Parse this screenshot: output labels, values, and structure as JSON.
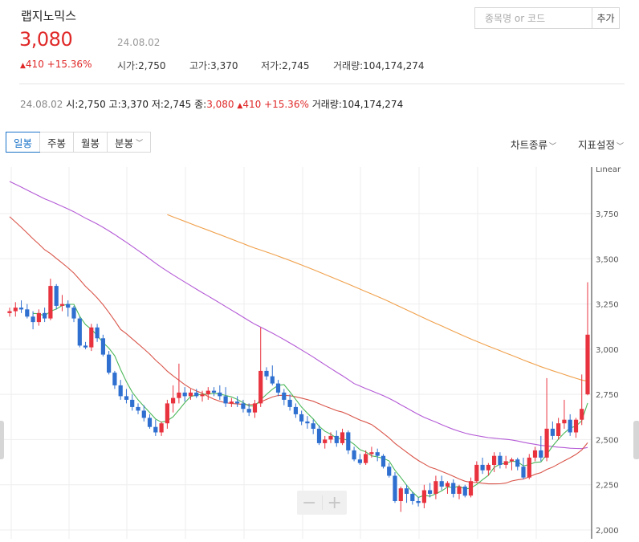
{
  "stock": {
    "name": "랩지노믹스",
    "price": "3,080",
    "date": "24.08.02",
    "change_arrow": "▲",
    "change": "410",
    "change_pct": "+15.36%"
  },
  "summary": {
    "open_label": "시가",
    "open": "2,750",
    "high_label": "고가",
    "high": "3,370",
    "low_label": "저가",
    "low": "2,745",
    "volume_label": "거래량",
    "volume": "104,174,274"
  },
  "search": {
    "placeholder": "종목명 or 코드",
    "add_label": "추가"
  },
  "ohlc_row": {
    "date": "24.08.02",
    "open_label": "시",
    "open": "2,750",
    "high_label": "고",
    "high": "3,370",
    "low_label": "저",
    "low": "2,745",
    "close_label": "종",
    "close": "3,080",
    "change_arrow": "▲",
    "change": "410",
    "change_pct": "+15.36%",
    "volume_label": "거래량",
    "volume": "104,174,274"
  },
  "toolbar": {
    "tabs": [
      {
        "label": "일봉",
        "active": true
      },
      {
        "label": "주봉"
      },
      {
        "label": "월봉"
      },
      {
        "label": "분봉",
        "dropdown": true
      }
    ],
    "chart_type_label": "차트종류",
    "indicator_label": "지표설정"
  },
  "colors": {
    "up": "#e8333f",
    "down": "#2e6fd0",
    "ma5": "#4cb85a",
    "ma20": "#d9554a",
    "ma60": "#b45ad6",
    "ma120": "#f0a04b",
    "accent": "#1a73c8"
  },
  "chart_data": {
    "type": "candlestick",
    "scale_label": "Linear",
    "y_ticks": [
      "3,750",
      "3,500",
      "3,250",
      "3,000",
      "2,750",
      "2,500",
      "2,250",
      "2,000"
    ],
    "ylim": [
      2000,
      3950
    ],
    "grid": true,
    "candles": [
      [
        3200,
        3230,
        3180,
        3210
      ],
      [
        3210,
        3260,
        3180,
        3230
      ],
      [
        3230,
        3270,
        3200,
        3220
      ],
      [
        3220,
        3250,
        3170,
        3180
      ],
      [
        3180,
        3210,
        3110,
        3150
      ],
      [
        3150,
        3220,
        3130,
        3200
      ],
      [
        3200,
        3230,
        3150,
        3170
      ],
      [
        3170,
        3390,
        3160,
        3350
      ],
      [
        3350,
        3360,
        3220,
        3240
      ],
      [
        3240,
        3300,
        3210,
        3250
      ],
      [
        3250,
        3270,
        3180,
        3230
      ],
      [
        3230,
        3240,
        3150,
        3170
      ],
      [
        3170,
        3180,
        3010,
        3020
      ],
      [
        3020,
        3040,
        3000,
        3010
      ],
      [
        3010,
        3140,
        2990,
        3120
      ],
      [
        3120,
        3140,
        3040,
        3060
      ],
      [
        3060,
        3080,
        2960,
        2970
      ],
      [
        2970,
        2990,
        2860,
        2870
      ],
      [
        2870,
        2880,
        2780,
        2800
      ],
      [
        2800,
        2830,
        2720,
        2740
      ],
      [
        2740,
        2780,
        2700,
        2720
      ],
      [
        2720,
        2750,
        2660,
        2680
      ],
      [
        2680,
        2700,
        2640,
        2660
      ],
      [
        2660,
        2690,
        2600,
        2620
      ],
      [
        2620,
        2640,
        2560,
        2570
      ],
      [
        2570,
        2610,
        2520,
        2540
      ],
      [
        2540,
        2600,
        2520,
        2590
      ],
      [
        2590,
        2720,
        2560,
        2700
      ],
      [
        2700,
        2800,
        2650,
        2730
      ],
      [
        2730,
        2920,
        2700,
        2760
      ],
      [
        2760,
        2790,
        2710,
        2740
      ],
      [
        2740,
        2780,
        2720,
        2760
      ],
      [
        2760,
        2780,
        2730,
        2740
      ],
      [
        2740,
        2770,
        2710,
        2750
      ],
      [
        2750,
        2790,
        2720,
        2770
      ],
      [
        2770,
        2790,
        2740,
        2760
      ],
      [
        2760,
        2800,
        2720,
        2740
      ],
      [
        2740,
        2790,
        2680,
        2700
      ],
      [
        2700,
        2730,
        2680,
        2710
      ],
      [
        2710,
        2740,
        2680,
        2700
      ],
      [
        2700,
        2720,
        2650,
        2670
      ],
      [
        2670,
        2700,
        2630,
        2650
      ],
      [
        2650,
        2720,
        2620,
        2700
      ],
      [
        2700,
        3120,
        2680,
        2880
      ],
      [
        2880,
        2900,
        2830,
        2850
      ],
      [
        2850,
        2910,
        2800,
        2810
      ],
      [
        2810,
        2830,
        2740,
        2760
      ],
      [
        2760,
        2780,
        2690,
        2720
      ],
      [
        2720,
        2750,
        2660,
        2680
      ],
      [
        2680,
        2700,
        2620,
        2640
      ],
      [
        2640,
        2660,
        2580,
        2600
      ],
      [
        2600,
        2630,
        2560,
        2590
      ],
      [
        2590,
        2610,
        2530,
        2560
      ],
      [
        2560,
        2580,
        2470,
        2480
      ],
      [
        2480,
        2520,
        2450,
        2500
      ],
      [
        2500,
        2540,
        2480,
        2520
      ],
      [
        2520,
        2550,
        2460,
        2480
      ],
      [
        2480,
        2560,
        2470,
        2540
      ],
      [
        2540,
        2550,
        2420,
        2440
      ],
      [
        2440,
        2460,
        2380,
        2390
      ],
      [
        2390,
        2420,
        2360,
        2370
      ],
      [
        2370,
        2440,
        2360,
        2420
      ],
      [
        2420,
        2460,
        2400,
        2430
      ],
      [
        2430,
        2450,
        2380,
        2410
      ],
      [
        2410,
        2420,
        2340,
        2350
      ],
      [
        2350,
        2370,
        2290,
        2300
      ],
      [
        2300,
        2320,
        2150,
        2160
      ],
      [
        2160,
        2240,
        2100,
        2230
      ],
      [
        2230,
        2250,
        2150,
        2200
      ],
      [
        2200,
        2210,
        2140,
        2160
      ],
      [
        2160,
        2180,
        2130,
        2150
      ],
      [
        2150,
        2250,
        2120,
        2220
      ],
      [
        2220,
        2260,
        2180,
        2200
      ],
      [
        2200,
        2300,
        2170,
        2270
      ],
      [
        2270,
        2300,
        2220,
        2240
      ],
      [
        2240,
        2270,
        2200,
        2260
      ],
      [
        2260,
        2280,
        2180,
        2200
      ],
      [
        2200,
        2250,
        2170,
        2240
      ],
      [
        2240,
        2250,
        2180,
        2190
      ],
      [
        2190,
        2290,
        2180,
        2270
      ],
      [
        2270,
        2380,
        2260,
        2360
      ],
      [
        2360,
        2400,
        2310,
        2330
      ],
      [
        2330,
        2370,
        2300,
        2360
      ],
      [
        2360,
        2430,
        2320,
        2410
      ],
      [
        2410,
        2430,
        2340,
        2360
      ],
      [
        2360,
        2410,
        2340,
        2380
      ],
      [
        2380,
        2400,
        2330,
        2390
      ],
      [
        2390,
        2400,
        2330,
        2350
      ],
      [
        2350,
        2400,
        2280,
        2290
      ],
      [
        2290,
        2420,
        2280,
        2400
      ],
      [
        2400,
        2460,
        2380,
        2440
      ],
      [
        2440,
        2520,
        2380,
        2400
      ],
      [
        2400,
        2840,
        2380,
        2560
      ],
      [
        2560,
        2600,
        2500,
        2520
      ],
      [
        2520,
        2620,
        2500,
        2590
      ],
      [
        2590,
        2720,
        2560,
        2610
      ],
      [
        2610,
        2640,
        2520,
        2540
      ],
      [
        2540,
        2620,
        2510,
        2610
      ],
      [
        2610,
        2860,
        2580,
        2670
      ],
      [
        2750,
        3370,
        2745,
        3080
      ]
    ],
    "ma120_start_index": 27
  }
}
